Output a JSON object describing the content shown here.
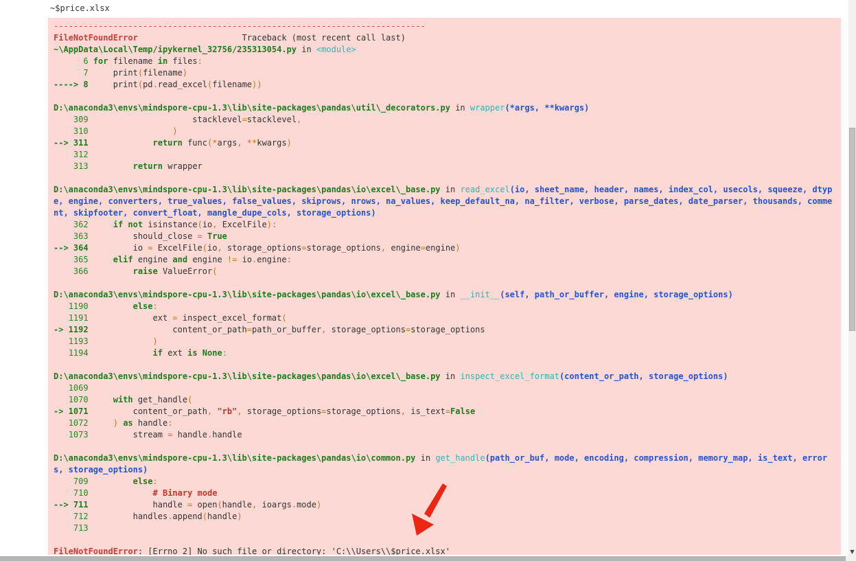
{
  "output": {
    "printed_filename": "~$price.xlsx"
  },
  "colors": {
    "error_background": "#fcd9d5",
    "error_red": "#ca3c38",
    "path_green": "#1c7c1c",
    "line_number_green": "#1f8b1f",
    "function_cyan": "#2cb5b5",
    "args_blue": "#2253d4",
    "operator_orange": "#b97a18",
    "annotation_arrow_red": "#ec2613",
    "scrollbar_thumb": "#c1c1c1"
  },
  "icons": {
    "scroll_down": "▼"
  },
  "annotation": {
    "type": "red-arrow",
    "color": "#ec2613"
  },
  "traceback": {
    "divider": "---------------------------------------------------------------------------",
    "error_name": "FileNotFoundError",
    "header_gap": "                     ",
    "header_right": "Traceback (most recent call last)",
    "frames": [
      {
        "location": [
          [
            "~\\AppData\\Local\\Temp/ipykernel_32756/235313054.py",
            "pa"
          ],
          [
            " in ",
            "p"
          ],
          [
            "<module>",
            "fn"
          ]
        ],
        "lines": [
          {
            "pre": "      6 ",
            "hot": false,
            "code": [
              [
                "for",
                "k"
              ],
              [
                " filename ",
                "p"
              ],
              [
                "in",
                "k"
              ],
              [
                " files",
                "p"
              ],
              [
                ":",
                "o"
              ]
            ]
          },
          {
            "pre": "      7 ",
            "hot": false,
            "code": [
              [
                "    print",
                "p"
              ],
              [
                "(",
                "o"
              ],
              [
                "filename",
                "p"
              ],
              [
                ")",
                "o"
              ]
            ]
          },
          {
            "pre": "----> 8 ",
            "hot": true,
            "code": [
              [
                "    print",
                "p"
              ],
              [
                "(",
                "o"
              ],
              [
                "pd",
                "p"
              ],
              [
                ".",
                "o"
              ],
              [
                "read_excel",
                "p"
              ],
              [
                "(",
                "o"
              ],
              [
                "filename",
                "p"
              ],
              [
                "))",
                "o"
              ]
            ]
          }
        ]
      },
      {
        "location": [
          [
            "D:\\anaconda3\\envs\\mindspore-cpu-1.3\\lib\\site-packages\\pandas\\util\\_decorators.py",
            "pa"
          ],
          [
            " in ",
            "p"
          ],
          [
            "wrapper",
            "fn"
          ],
          [
            "(*args, **kwargs)",
            "ar"
          ]
        ],
        "lines": [
          {
            "pre": "    309 ",
            "hot": false,
            "code": [
              [
                "                    stacklevel",
                "p"
              ],
              [
                "=",
                "o"
              ],
              [
                "stacklevel",
                "p"
              ],
              [
                ",",
                "o"
              ]
            ]
          },
          {
            "pre": "    310 ",
            "hot": false,
            "code": [
              [
                "                )",
                "o"
              ]
            ]
          },
          {
            "pre": "--> 311 ",
            "hot": true,
            "code": [
              [
                "            ",
                "p"
              ],
              [
                "return",
                "k"
              ],
              [
                " func",
                "p"
              ],
              [
                "(*",
                "o"
              ],
              [
                "args",
                "p"
              ],
              [
                ", **",
                "o"
              ],
              [
                "kwargs",
                "p"
              ],
              [
                ")",
                "o"
              ]
            ]
          },
          {
            "pre": "    312 ",
            "hot": false,
            "code": []
          },
          {
            "pre": "    313 ",
            "hot": false,
            "code": [
              [
                "        ",
                "p"
              ],
              [
                "return",
                "k"
              ],
              [
                " wrapper",
                "p"
              ]
            ]
          }
        ]
      },
      {
        "location": [
          [
            "D:\\anaconda3\\envs\\mindspore-cpu-1.3\\lib\\site-packages\\pandas\\io\\excel\\_base.py",
            "pa"
          ],
          [
            " in ",
            "p"
          ],
          [
            "read_excel",
            "fn"
          ],
          [
            "(io, sheet_name, header, names, index_col, usecols, squeeze, dtype, engine, converters, true_values, false_values, skiprows, nrows, na_values, keep_default_na, na_filter, verbose, parse_dates, date_parser, thousands, comment, skipfooter, convert_float, mangle_dupe_cols, storage_options)",
            "ar"
          ]
        ],
        "lines": [
          {
            "pre": "    362 ",
            "hot": false,
            "code": [
              [
                "    ",
                "p"
              ],
              [
                "if",
                "k"
              ],
              [
                " ",
                "p"
              ],
              [
                "not",
                "k"
              ],
              [
                " isinstance",
                "p"
              ],
              [
                "(",
                "o"
              ],
              [
                "io",
                "p"
              ],
              [
                ",",
                "o"
              ],
              [
                " ExcelFile",
                "p"
              ],
              [
                "):",
                "o"
              ]
            ]
          },
          {
            "pre": "    363 ",
            "hot": false,
            "code": [
              [
                "        should_close ",
                "p"
              ],
              [
                "=",
                "o"
              ],
              [
                " ",
                "p"
              ],
              [
                "True",
                "k"
              ]
            ]
          },
          {
            "pre": "--> 364 ",
            "hot": true,
            "code": [
              [
                "        io ",
                "p"
              ],
              [
                "=",
                "o"
              ],
              [
                " ExcelFile",
                "p"
              ],
              [
                "(",
                "o"
              ],
              [
                "io",
                "p"
              ],
              [
                ",",
                "o"
              ],
              [
                " storage_options",
                "p"
              ],
              [
                "=",
                "o"
              ],
              [
                "storage_options",
                "p"
              ],
              [
                ",",
                "o"
              ],
              [
                " engine",
                "p"
              ],
              [
                "=",
                "o"
              ],
              [
                "engine",
                "p"
              ],
              [
                ")",
                "o"
              ]
            ]
          },
          {
            "pre": "    365 ",
            "hot": false,
            "code": [
              [
                "    ",
                "p"
              ],
              [
                "elif",
                "k"
              ],
              [
                " engine ",
                "p"
              ],
              [
                "and",
                "k"
              ],
              [
                " engine ",
                "p"
              ],
              [
                "!=",
                "o"
              ],
              [
                " io",
                "p"
              ],
              [
                ".",
                "o"
              ],
              [
                "engine",
                "p"
              ],
              [
                ":",
                "o"
              ]
            ]
          },
          {
            "pre": "    366 ",
            "hot": false,
            "code": [
              [
                "        ",
                "p"
              ],
              [
                "raise",
                "k"
              ],
              [
                " ValueError",
                "p"
              ],
              [
                "(",
                "o"
              ]
            ]
          }
        ]
      },
      {
        "location": [
          [
            "D:\\anaconda3\\envs\\mindspore-cpu-1.3\\lib\\site-packages\\pandas\\io\\excel\\_base.py",
            "pa"
          ],
          [
            " in ",
            "p"
          ],
          [
            "__init__",
            "fn"
          ],
          [
            "(self, path_or_buffer, engine, storage_options)",
            "ar"
          ]
        ],
        "lines": [
          {
            "pre": "   1190 ",
            "hot": false,
            "code": [
              [
                "        ",
                "p"
              ],
              [
                "else",
                "k"
              ],
              [
                ":",
                "o"
              ]
            ]
          },
          {
            "pre": "   1191 ",
            "hot": false,
            "code": [
              [
                "            ext ",
                "p"
              ],
              [
                "=",
                "o"
              ],
              [
                " inspect_excel_format",
                "p"
              ],
              [
                "(",
                "o"
              ]
            ]
          },
          {
            "pre": "-> 1192 ",
            "hot": true,
            "code": [
              [
                "                content_or_path",
                "p"
              ],
              [
                "=",
                "o"
              ],
              [
                "path_or_buffer",
                "p"
              ],
              [
                ",",
                "o"
              ],
              [
                " storage_options",
                "p"
              ],
              [
                "=",
                "o"
              ],
              [
                "storage_options",
                "p"
              ]
            ]
          },
          {
            "pre": "   1193 ",
            "hot": false,
            "code": [
              [
                "            )",
                "o"
              ]
            ]
          },
          {
            "pre": "   1194 ",
            "hot": false,
            "code": [
              [
                "            ",
                "p"
              ],
              [
                "if",
                "k"
              ],
              [
                " ext ",
                "p"
              ],
              [
                "is",
                "k"
              ],
              [
                " ",
                "p"
              ],
              [
                "None",
                "k"
              ],
              [
                ":",
                "o"
              ]
            ]
          }
        ]
      },
      {
        "location": [
          [
            "D:\\anaconda3\\envs\\mindspore-cpu-1.3\\lib\\site-packages\\pandas\\io\\excel\\_base.py",
            "pa"
          ],
          [
            " in ",
            "p"
          ],
          [
            "inspect_excel_format",
            "fn"
          ],
          [
            "(content_or_path, storage_options)",
            "ar"
          ]
        ],
        "lines": [
          {
            "pre": "   1069 ",
            "hot": false,
            "code": []
          },
          {
            "pre": "   1070 ",
            "hot": false,
            "code": [
              [
                "    ",
                "p"
              ],
              [
                "with",
                "k"
              ],
              [
                " get_handle",
                "p"
              ],
              [
                "(",
                "o"
              ]
            ]
          },
          {
            "pre": "-> 1071 ",
            "hot": true,
            "code": [
              [
                "        content_or_path",
                "p"
              ],
              [
                ",",
                "o"
              ],
              [
                " ",
                "p"
              ],
              [
                "\"rb\"",
                "s"
              ],
              [
                ",",
                "o"
              ],
              [
                " storage_options",
                "p"
              ],
              [
                "=",
                "o"
              ],
              [
                "storage_options",
                "p"
              ],
              [
                ",",
                "o"
              ],
              [
                " is_text",
                "p"
              ],
              [
                "=",
                "o"
              ],
              [
                "False",
                "k"
              ]
            ]
          },
          {
            "pre": "   1072 ",
            "hot": false,
            "code": [
              [
                "    ",
                "p"
              ],
              [
                ")",
                "o"
              ],
              [
                " ",
                "p"
              ],
              [
                "as",
                "k"
              ],
              [
                " handle",
                "p"
              ],
              [
                ":",
                "o"
              ]
            ]
          },
          {
            "pre": "   1073 ",
            "hot": false,
            "code": [
              [
                "        stream ",
                "p"
              ],
              [
                "=",
                "o"
              ],
              [
                " handle",
                "p"
              ],
              [
                ".",
                "o"
              ],
              [
                "handle",
                "p"
              ]
            ]
          }
        ]
      },
      {
        "location": [
          [
            "D:\\anaconda3\\envs\\mindspore-cpu-1.3\\lib\\site-packages\\pandas\\io\\common.py",
            "pa"
          ],
          [
            " in ",
            "p"
          ],
          [
            "get_handle",
            "fn"
          ],
          [
            "(path_or_buf, mode, encoding, compression, memory_map, is_text, errors, storage_options)",
            "ar"
          ]
        ],
        "lines": [
          {
            "pre": "    709 ",
            "hot": false,
            "code": [
              [
                "        ",
                "p"
              ],
              [
                "else",
                "k"
              ],
              [
                ":",
                "o"
              ]
            ]
          },
          {
            "pre": "    710 ",
            "hot": false,
            "code": [
              [
                "            ",
                "p"
              ],
              [
                "# Binary mode",
                "c"
              ]
            ]
          },
          {
            "pre": "--> 711 ",
            "hot": true,
            "code": [
              [
                "            handle ",
                "p"
              ],
              [
                "=",
                "o"
              ],
              [
                " open",
                "p"
              ],
              [
                "(",
                "o"
              ],
              [
                "handle",
                "p"
              ],
              [
                ",",
                "o"
              ],
              [
                " ioargs",
                "p"
              ],
              [
                ".",
                "o"
              ],
              [
                "mode",
                "p"
              ],
              [
                ")",
                "o"
              ]
            ]
          },
          {
            "pre": "    712 ",
            "hot": false,
            "code": [
              [
                "        handles",
                "p"
              ],
              [
                ".",
                "o"
              ],
              [
                "append",
                "p"
              ],
              [
                "(",
                "o"
              ],
              [
                "handle",
                "p"
              ],
              [
                ")",
                "o"
              ]
            ]
          },
          {
            "pre": "    713 ",
            "hot": false,
            "code": []
          }
        ]
      }
    ],
    "final_error": [
      [
        "FileNotFoundError",
        "er"
      ],
      [
        ": [Errno 2] No such file or directory: ",
        "p"
      ],
      [
        "'C:\\\\Users\\\\$price.xlsx'",
        "p"
      ]
    ]
  }
}
